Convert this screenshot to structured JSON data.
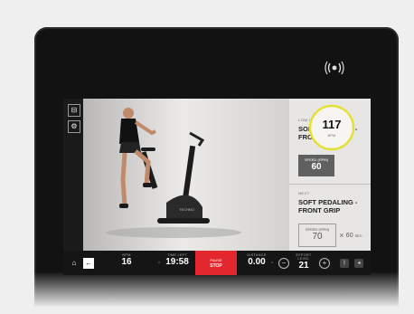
{
  "workout": {
    "intensity_label": "LOW INTENSITY",
    "current_title": "SOFT PEDALING -\nFRONT GRIP",
    "target_rpm_label": "SPEED (RPM)",
    "target_rpm": "60",
    "heart_rate": "117",
    "heart_rate_unit": "BPM",
    "next_label": "NEXT",
    "next_title": "SOFT PEDALING -\nFRONT GRIP",
    "next_rpm_label": "SPEED (RPM)",
    "next_rpm": "70",
    "next_duration": "⨯ 60",
    "next_duration_unit": "SEC"
  },
  "bottom": {
    "rpm_label": "RPM",
    "rpm_value": "16",
    "time_label": "TIME LEFT",
    "time_value": "19:58",
    "pause_line1": "PAUSE",
    "pause_line2": "STOP",
    "distance_label": "DISTANCE",
    "distance_value": "0.00",
    "effort_label": "EFFORT LEVEL",
    "effort_value": "21",
    "minus_label": "−",
    "plus_label": "+"
  },
  "icons": {
    "home": "home-icon",
    "back": "back-arrow-icon"
  }
}
